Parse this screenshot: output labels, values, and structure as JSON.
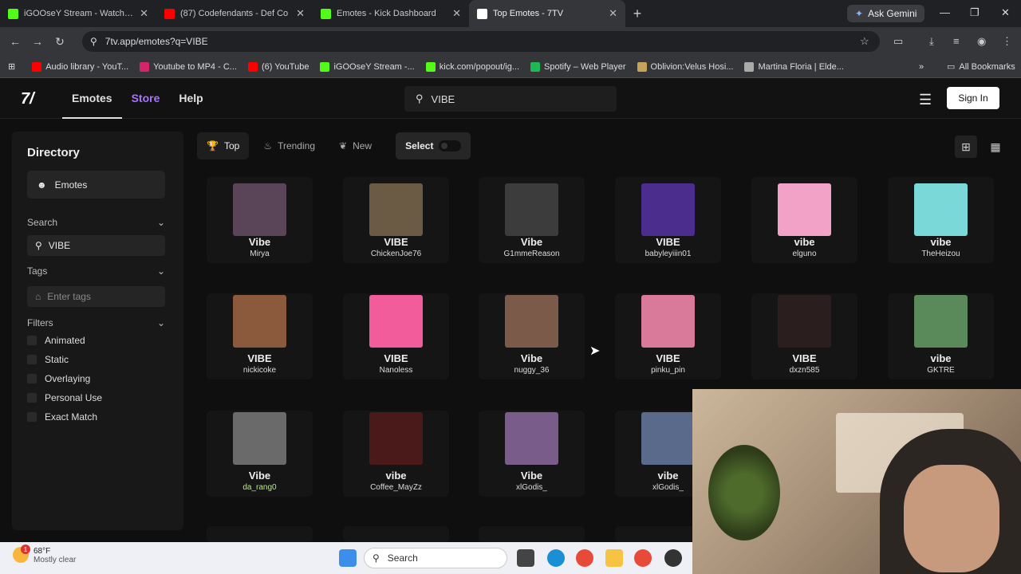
{
  "browser": {
    "tabs": [
      {
        "title": "iGOOseY Stream - Watch Live o",
        "icon": "kick-icon",
        "color": "#53fc18"
      },
      {
        "title": "(87) Codefendants - Def Co",
        "icon": "youtube-icon",
        "color": "#ff0000"
      },
      {
        "title": "Emotes - Kick Dashboard",
        "icon": "kick-icon",
        "color": "#53fc18"
      },
      {
        "title": "Top Emotes - 7TV",
        "icon": "7tv-icon",
        "color": "#ffffff"
      }
    ],
    "new_tab": "+",
    "gemini": "Ask Gemini",
    "url": "7tv.app/emotes?q=VIBE",
    "bookmarks": [
      {
        "label": "Audio library - YouT...",
        "color": "#ff0000"
      },
      {
        "label": "Youtube to MP4 - C...",
        "color": "#d5246b"
      },
      {
        "label": "(6) YouTube",
        "color": "#ff0000"
      },
      {
        "label": "iGOOseY Stream -...",
        "color": "#53fc18"
      },
      {
        "label": "kick.com/popout/ig...",
        "color": "#53fc18"
      },
      {
        "label": "Spotify – Web Player",
        "color": "#1db954"
      },
      {
        "label": "Oblivion:Velus Hosi...",
        "color": "#c7a25a"
      },
      {
        "label": "Martina Floria | Elde...",
        "color": "#aaaaaa"
      }
    ],
    "all_bookmarks": "All Bookmarks"
  },
  "site": {
    "logo": "7/",
    "nav": {
      "emotes": "Emotes",
      "store": "Store",
      "help": "Help"
    },
    "search_value": "VIBE",
    "sign_in": "Sign In"
  },
  "sidebar": {
    "title": "Directory",
    "emotes": "Emotes",
    "search_label": "Search",
    "search_value": "VIBE",
    "tags_label": "Tags",
    "tags_placeholder": "Enter tags",
    "filters_label": "Filters",
    "filters": [
      "Animated",
      "Static",
      "Overlaying",
      "Personal Use",
      "Exact Match"
    ]
  },
  "sort": {
    "top": "Top",
    "trending": "Trending",
    "new": "New",
    "select": "Select"
  },
  "emotes": [
    {
      "name": "Vibe",
      "owner": "Mirya",
      "color": "#5a4457"
    },
    {
      "name": "VIBE",
      "owner": "ChickenJoe76",
      "color": "#6b5a44"
    },
    {
      "name": "Vibe",
      "owner": "G1mmeReason",
      "color": "#3c3c3c"
    },
    {
      "name": "VIBE",
      "owner": "babyleyiiin01",
      "color": "#4a2d8c"
    },
    {
      "name": "vibe",
      "owner": "elguno",
      "color": "#f2a2c7"
    },
    {
      "name": "vibe",
      "owner": "TheHeizou",
      "color": "#7ad8d8"
    },
    {
      "name": "VIBE",
      "owner": "nickicoke",
      "color": "#8b5a3c"
    },
    {
      "name": "VIBE",
      "owner": "Nanoless",
      "color": "#f25c9a"
    },
    {
      "name": "Vibe",
      "owner": "nuggy_36",
      "color": "#7c5a4a"
    },
    {
      "name": "VIBE",
      "owner": "pinku_pin",
      "color": "#d97a9a"
    },
    {
      "name": "VIBE",
      "owner": "dxzn585",
      "color": "#2a1e1e"
    },
    {
      "name": "vibe",
      "owner": "GKTRE",
      "color": "#5a8a5a"
    },
    {
      "name": "Vibe",
      "owner": "da_rang0",
      "color": "#6a6a6a",
      "owner_color": "#b8e986"
    },
    {
      "name": "vibe",
      "owner": "Coffee_MayZz",
      "color": "#4a1a1a"
    },
    {
      "name": "Vibe",
      "owner": "xlGodis_",
      "color": "#7a5c8a"
    },
    {
      "name": "vibe",
      "owner": "xlGodis_",
      "color": "#5a6a8a"
    }
  ],
  "taskbar": {
    "temp": "68°F",
    "condition": "Mostly clear",
    "badge": "1",
    "search": "Search"
  }
}
